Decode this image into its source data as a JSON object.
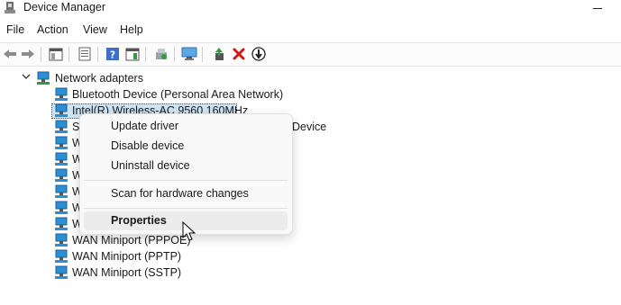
{
  "window": {
    "title": "Device Manager",
    "app_icon": "device-manager-icon"
  },
  "menu": [
    "File",
    "Action",
    "View",
    "Help"
  ],
  "toolbar": {
    "icons": [
      "back-arrow-icon",
      "forward-arrow-icon",
      "show-hide-console-tree-icon",
      "properties-icon",
      "help-icon",
      "action-pane-icon",
      "update-driver-icon",
      "scan-hardware-icon",
      "enable-device-icon",
      "uninstall-device-icon",
      "disable-device-icon"
    ]
  },
  "tree": {
    "category": "Network adapters",
    "devices": [
      "Bluetooth Device (Personal Area Network)",
      "Intel(R) Wireless-AC 9560 160MHz",
      "Device",
      "WAN Miniport (PPPOE)",
      "WAN Miniport (PPTP)",
      "WAN Miniport (SSTP)"
    ],
    "hidden_row_prefixes": [
      "S",
      "W",
      "W",
      "W",
      "W",
      "W",
      "W"
    ]
  },
  "context_menu": {
    "items": [
      "Update driver",
      "Disable device",
      "Uninstall device",
      "Scan for hardware changes",
      "Properties"
    ],
    "highlighted": "Properties"
  },
  "colors": {
    "selection": "#cfe3f7",
    "icon_blue": "#2b8fd6",
    "uninstall_red": "#d41616",
    "green": "#2e9e3a"
  }
}
